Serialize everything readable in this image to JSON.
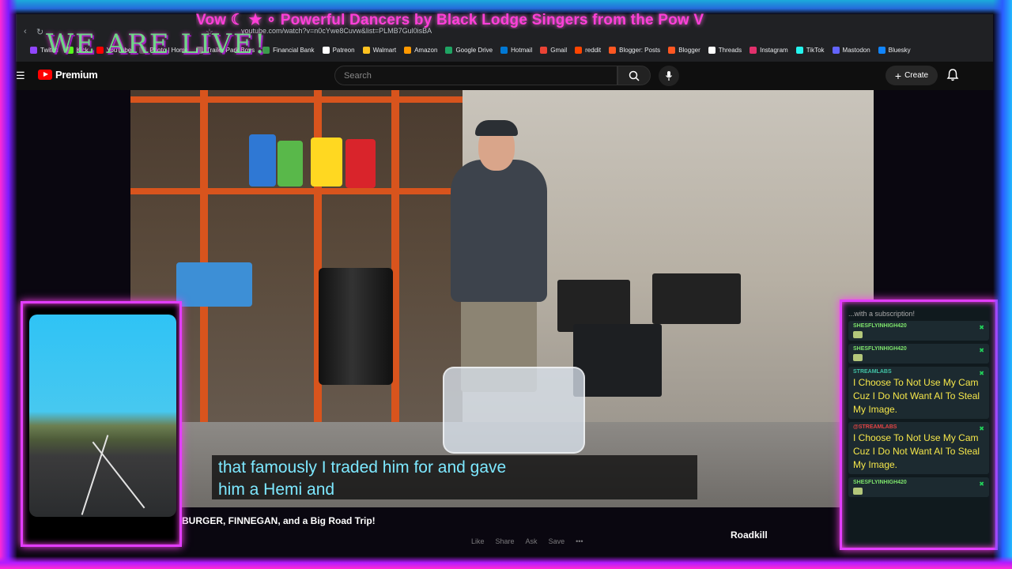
{
  "overlay": {
    "ticker": "Vow ☾ ★ ∘ Powerful Dancers by Black Lodge Singers from the Pow V",
    "headline": "WE ARE LIVE!"
  },
  "browser": {
    "url": "youtube.com/watch?v=n0cYwe8Cuvw&list=PLMB7Gul0isBA",
    "bookmarks": [
      {
        "label": "Twitch",
        "color": "#9146ff"
      },
      {
        "label": "Kick",
        "color": "#53fc18"
      },
      {
        "label": "YouTube",
        "color": "#ff0000"
      },
      {
        "label": "Photo | Home",
        "color": "#555555"
      },
      {
        "label": "Trailer Park Boys",
        "color": "#777777"
      },
      {
        "label": "Financial Bank",
        "color": "#3a9c4a"
      },
      {
        "label": "Patreon",
        "color": "#ffffff"
      },
      {
        "label": "Walmart",
        "color": "#ffc220"
      },
      {
        "label": "Amazon",
        "color": "#ff9900"
      },
      {
        "label": "Google Drive",
        "color": "#1fa463"
      },
      {
        "label": "Hotmail",
        "color": "#0078d4"
      },
      {
        "label": "Gmail",
        "color": "#ea4335"
      },
      {
        "label": "reddit",
        "color": "#ff4500"
      },
      {
        "label": "Blogger: Posts",
        "color": "#ff5722"
      },
      {
        "label": "Blogger",
        "color": "#ff5722"
      },
      {
        "label": "Threads",
        "color": "#ffffff"
      },
      {
        "label": "Instagram",
        "color": "#e1306c"
      },
      {
        "label": "TikTok",
        "color": "#25f4ee"
      },
      {
        "label": "Mastodon",
        "color": "#6364ff"
      },
      {
        "label": "Bluesky",
        "color": "#1185fe"
      }
    ]
  },
  "youtube": {
    "brand": "Premium",
    "search_placeholder": "Search",
    "create_label": "Create"
  },
  "video": {
    "caption_line1": "that famously I traded him for and gave",
    "caption_line2": "him a Hemi and",
    "title": "BURGER, FINNEGAN, and a Big Road Trip!",
    "channel": "Roadkill",
    "actions": [
      "Like",
      "Share",
      "Ask",
      "Save"
    ]
  },
  "chat": {
    "header": "...with a subscription!",
    "messages": [
      {
        "user": "SHESFLYINHIGH420",
        "user_color": "#7de36b",
        "text": "",
        "emote": true
      },
      {
        "user": "SHESFLYINHIGH420",
        "user_color": "#7de36b",
        "text": "",
        "emote": true
      },
      {
        "user": "STREAMLABS",
        "user_color": "#41c2a5",
        "text": "I Choose To Not Use My Cam Cuz I Do Not Want AI To Steal My Image.",
        "emote": false
      },
      {
        "user": "@STREAMLABS",
        "user_color": "#e24444",
        "text": "I Choose To Not Use My Cam Cuz I Do Not Want AI To Steal My Image.",
        "emote": false
      },
      {
        "user": "SHESFLYINHIGH420",
        "user_color": "#7de36b",
        "text": "",
        "emote": true
      }
    ]
  }
}
